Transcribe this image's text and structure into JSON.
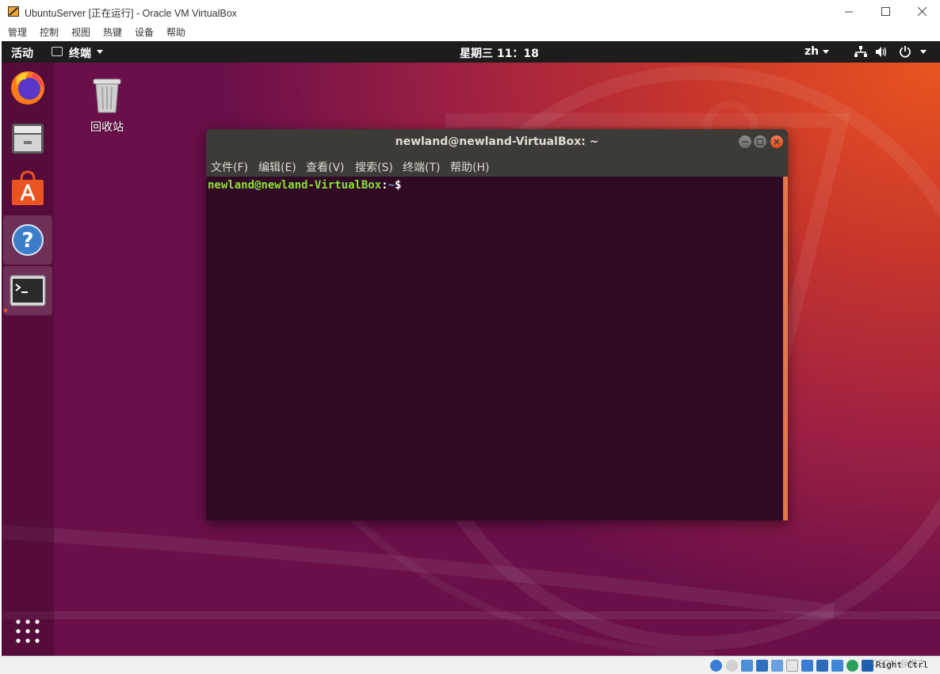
{
  "vbox": {
    "title": "UbuntuServer [正在运行] - Oracle VM VirtualBox",
    "menu": [
      "管理",
      "控制",
      "视图",
      "热键",
      "设备",
      "帮助"
    ],
    "host_key": "Right Ctrl",
    "watermark": "CSDN @相之"
  },
  "topbar": {
    "activities": "活动",
    "app_name": "终端",
    "clock": "星期三 11：18",
    "lang": "zh"
  },
  "desktop": {
    "trash_label": "回收站"
  },
  "dock": {
    "items": [
      "firefox-icon",
      "files-icon",
      "software-icon",
      "help-icon",
      "terminal-icon"
    ],
    "show_apps": "show-apps-icon"
  },
  "terminal": {
    "title": "newland@newland-VirtualBox: ~",
    "menu": [
      "文件(F)",
      "编辑(E)",
      "查看(V)",
      "搜索(S)",
      "终端(T)",
      "帮助(H)"
    ],
    "prompt_user": "newland@newland-VirtualBox",
    "prompt_sep": ":",
    "prompt_path": "~",
    "prompt_dollar": "$"
  },
  "colors": {
    "ubuntu_orange": "#e95420",
    "terminal_bg": "#300a24",
    "prompt_green": "#8ae234",
    "prompt_blue": "#729fcf"
  }
}
